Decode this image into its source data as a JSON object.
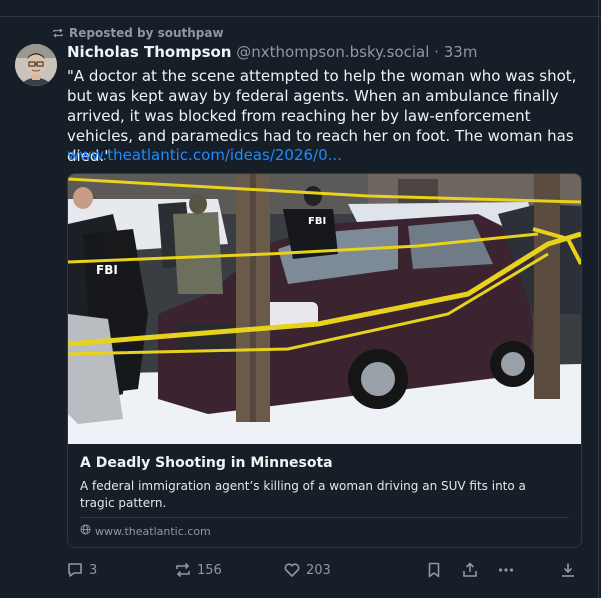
{
  "repost": {
    "label": "Reposted by southpaw",
    "icon": "repost-icon"
  },
  "author": {
    "name": "Nicholas Thompson",
    "handle": "@nxthompson.bsky.social",
    "separator": "·",
    "time": "33m"
  },
  "post": {
    "text": "\"A doctor at the scene attempted to help the woman who was shot, but was kept away by federal agents. When an ambulance finally arrived, it was blocked from reaching her by law-enforcement vehicles, and paramedics had to reach her on foot. The woman has died.\"",
    "link": "www.theatlantic.com/ideas/2026/0..."
  },
  "embed": {
    "title": "A Deadly Shooting in Minnesota",
    "description": "A federal immigration agent’s killing of a woman driving an SUV fits into a tragic pattern.",
    "domain": "www.theatlantic.com",
    "image_labels": {
      "agent_left": "FBI",
      "agent_center": "FBI"
    }
  },
  "actions": {
    "replies": "3",
    "reposts": "156",
    "likes": "203"
  },
  "colors": {
    "background": "#161e27",
    "link": "#208bfe",
    "muted": "#8b98a5",
    "border": "#2e3944"
  }
}
